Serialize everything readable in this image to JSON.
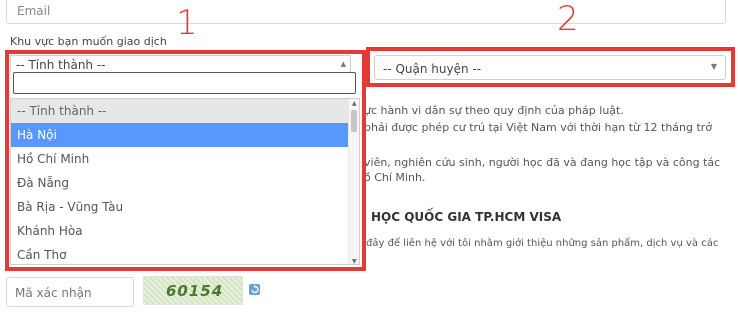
{
  "form": {
    "email_placeholder": "Email",
    "region_label": "Khu vực bạn muốn giao dịch",
    "captcha_placeholder": "Mã xác nhận",
    "captcha_code": "60154"
  },
  "annotations": {
    "first": "1",
    "second": "2"
  },
  "province_select": {
    "selected_text": "-- Tỉnh thành --",
    "options": [
      "-- Tỉnh thành --",
      "Hà Nội",
      "Hồ Chí Minh",
      "Đà Nẵng",
      "Bà Rịa - Vũng Tàu",
      "Khánh Hòa",
      "Cần Thơ"
    ],
    "highlighted": "Hà Nội"
  },
  "district_select": {
    "selected_text": "-- Quận huyện --"
  },
  "background_text": {
    "line1": "ực hành vi dân sự theo quy định của pháp luật.",
    "line2": "phải được phép cư trú tại Việt Nam với thời hạn từ 12 tháng trở",
    "line3": "viên, nghiên cứu sinh, người học đã và đang học tập và công tác",
    "line4": "ồ Chí Minh.",
    "heading": "HỌC QUỐC GIA TP.HCM VISA",
    "line5": "đây để liên hệ với tôi nhằm giới thiệu những sản phẩm, dịch vụ và các"
  },
  "colors": {
    "highlight": "#5897fb",
    "annotation": "#e53935"
  }
}
